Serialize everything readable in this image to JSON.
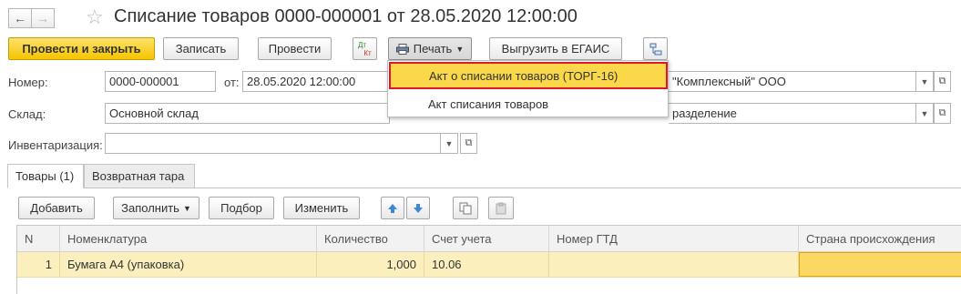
{
  "header": {
    "back_icon": "arrow-left",
    "forward_icon": "arrow-right",
    "favorite_icon": "star",
    "title": "Списание товаров 0000-000001 от 28.05.2020 12:00:00"
  },
  "toolbar": {
    "post_and_close": "Провести и закрыть",
    "save": "Записать",
    "post": "Провести",
    "dtkt_top": "Дт",
    "dtkt_bottom": "Кт",
    "print": "Печать",
    "export_egais": "Выгрузить в ЕГАИС",
    "structure_icon": "subordination-structure"
  },
  "print_menu": {
    "items": [
      {
        "label": "Акт о списании товаров (ТОРГ-16)",
        "selected": true
      },
      {
        "label": "Акт списания товаров",
        "selected": false
      }
    ]
  },
  "form": {
    "number_label": "Номер:",
    "number_value": "0000-000001",
    "date_label": "от:",
    "date_value": "28.05.2020 12:00:00",
    "organization_value": "\"Комплексный\" ООО",
    "warehouse_label": "Склад:",
    "warehouse_value": "Основной склад",
    "subdivision_value": "разделение",
    "inventory_label": "Инвентаризация:",
    "inventory_value": ""
  },
  "tabs": [
    {
      "label": "Товары (1)",
      "active": true
    },
    {
      "label": "Возвратная тара",
      "active": false
    }
  ],
  "table_toolbar": {
    "add": "Добавить",
    "fill": "Заполнить",
    "pick": "Подбор",
    "change": "Изменить",
    "up_icon": "arrow-up",
    "down_icon": "arrow-down",
    "copy_icon": "copy",
    "paste_icon": "paste"
  },
  "table": {
    "columns": [
      "N",
      "Номенклатура",
      "Количество",
      "Счет учета",
      "Номер ГТД",
      "Страна происхождения"
    ],
    "rows": [
      {
        "n": "1",
        "item": "Бумага А4 (упаковка)",
        "qty": "1,000",
        "account": "10.06",
        "gtd": "",
        "country": ""
      }
    ]
  },
  "colors": {
    "primary_button": "#f5c400",
    "selected_row": "#fbefbe",
    "menu_highlight": "#fbd84a",
    "highlight_border": "#e0162b"
  }
}
